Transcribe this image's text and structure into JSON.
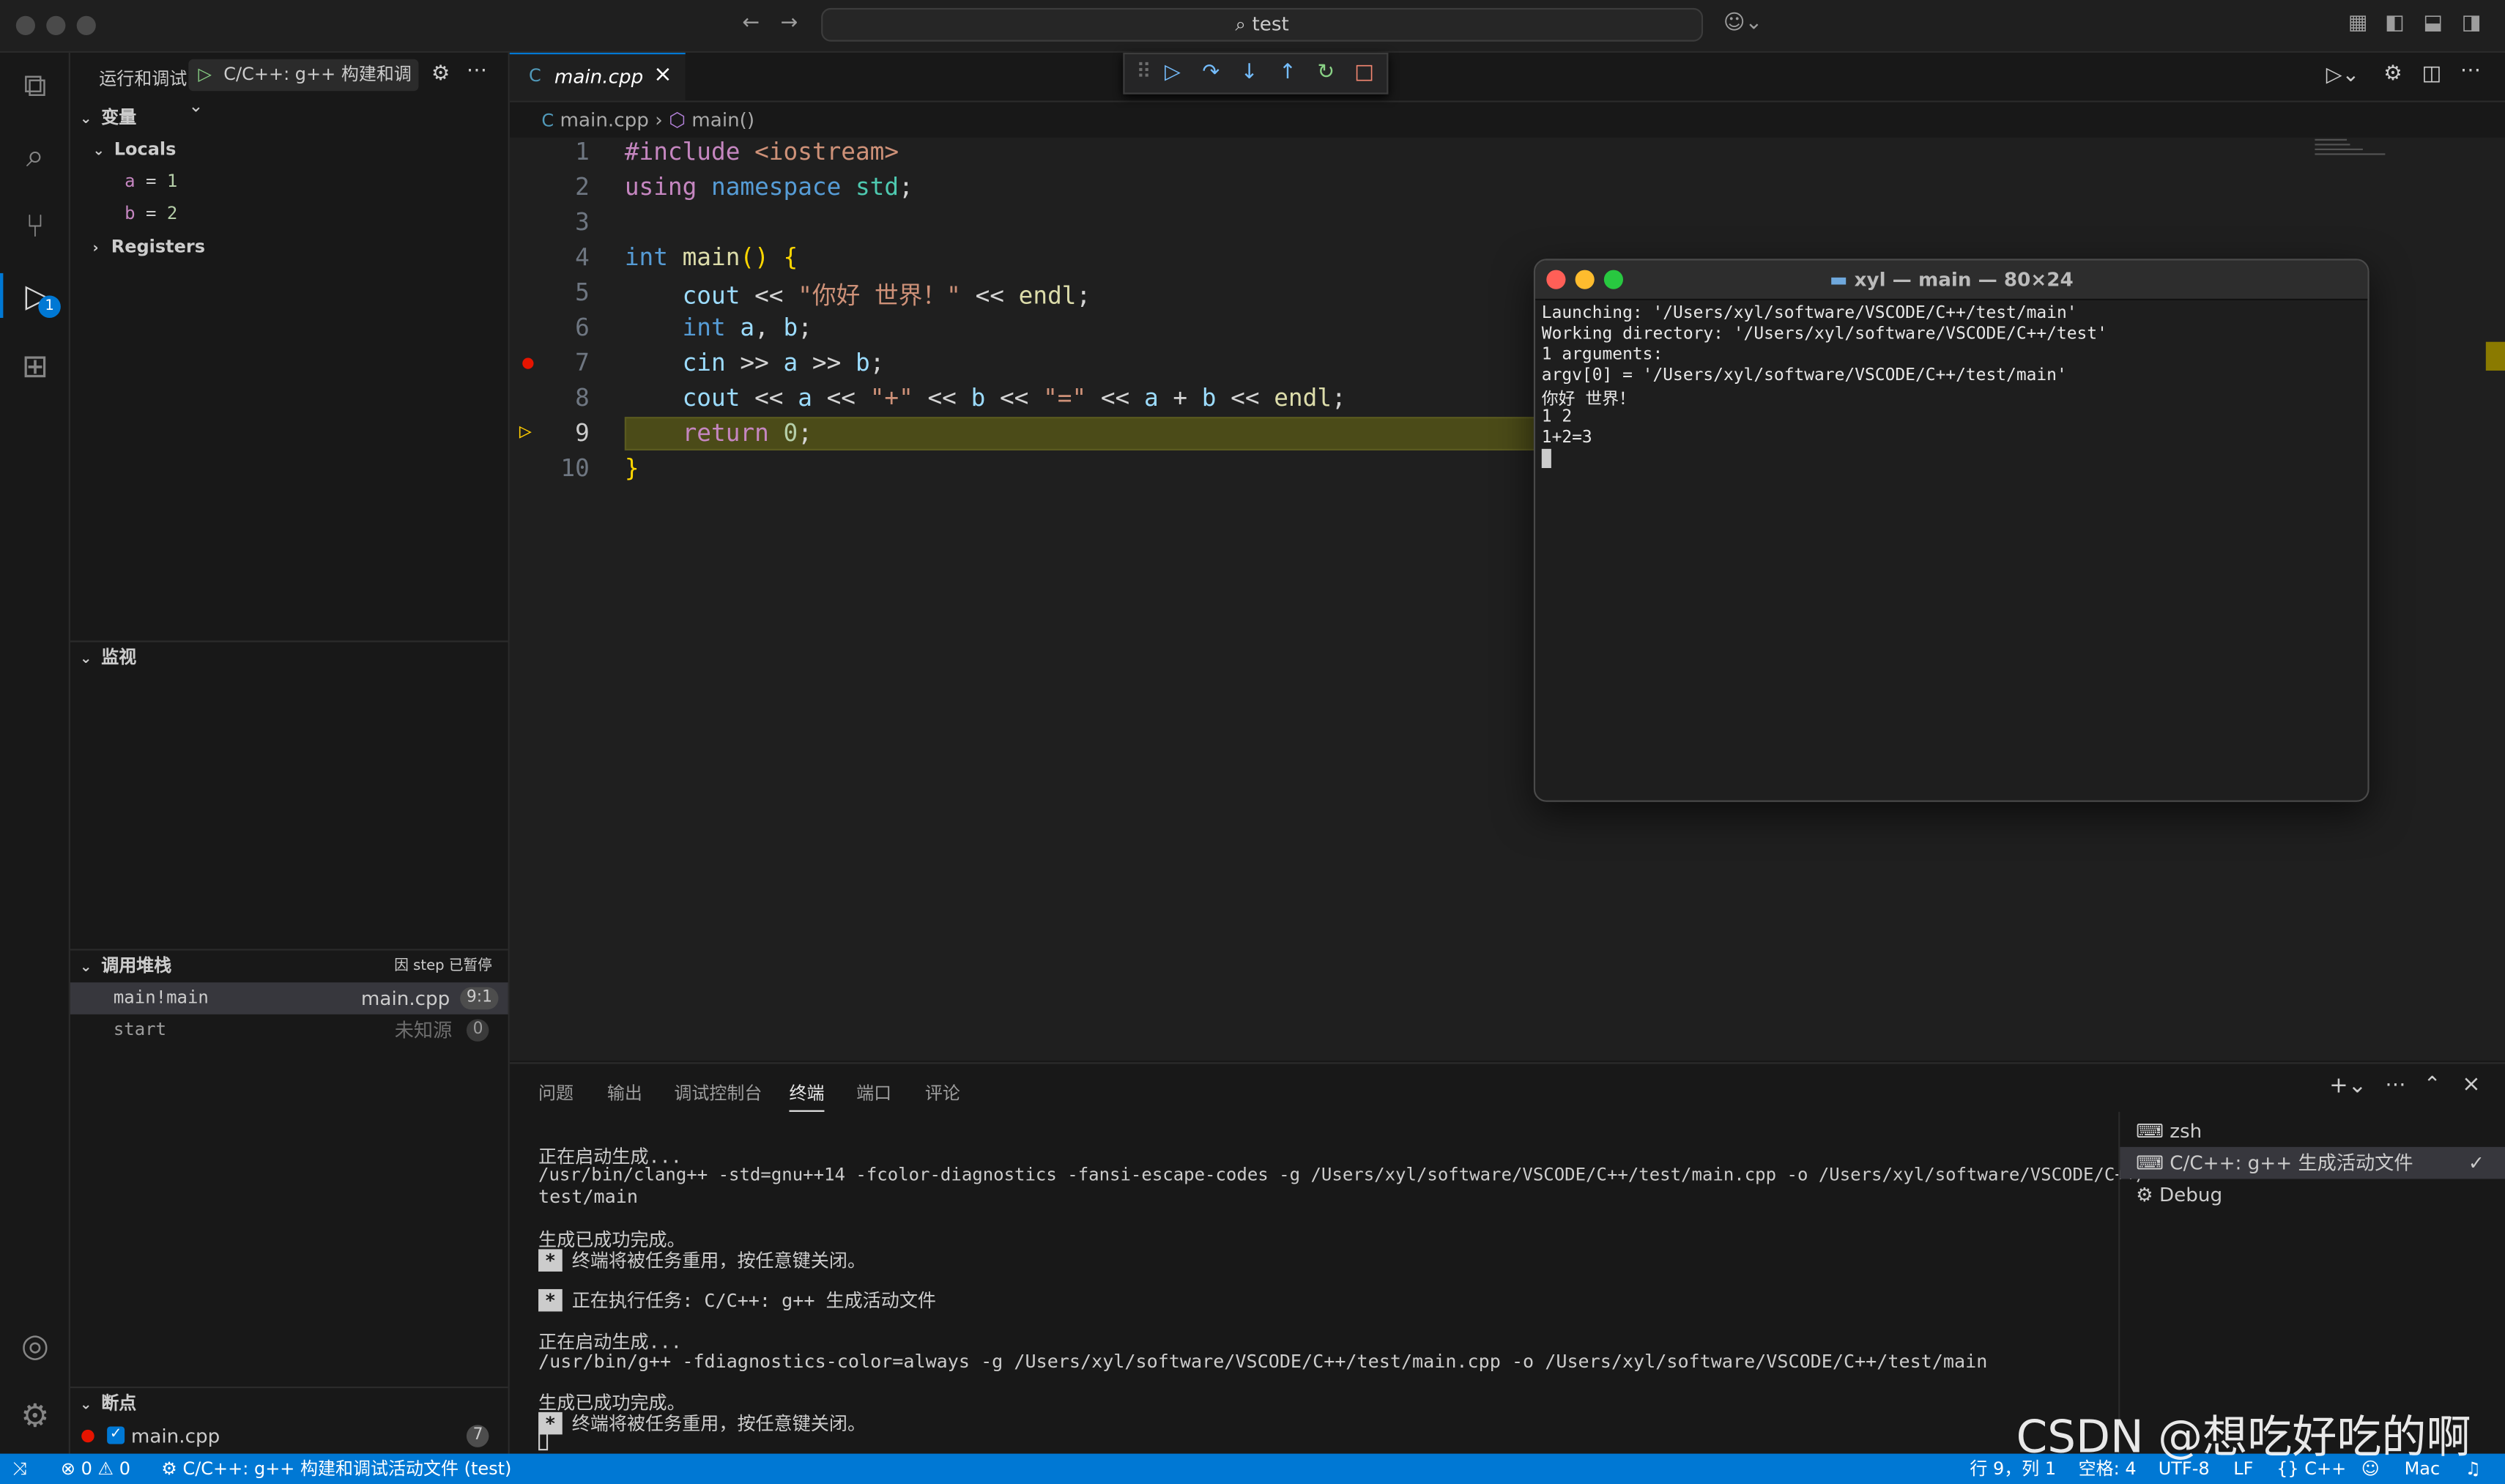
{
  "titlebar": {
    "search_text": "test"
  },
  "sidebar": {
    "run_title": "运行和调试",
    "config_name": "C/C++: g++ 构建和调",
    "variables_title": "变量",
    "locals_title": "Locals",
    "locals": [
      {
        "name": "a",
        "value": "1"
      },
      {
        "name": "b",
        "value": "2"
      }
    ],
    "registers_title": "Registers",
    "watch_title": "监视",
    "callstack_title": "调用堆栈",
    "callstack_status": "因 step 已暂停",
    "frames": [
      {
        "name": "main!main",
        "file": "main.cpp",
        "pos": "9:1"
      },
      {
        "name": "start",
        "file": "未知源",
        "pos": "0"
      }
    ],
    "breakpoints_title": "断点",
    "breakpoint_file": "main.cpp",
    "breakpoint_line": "7"
  },
  "editor": {
    "tab_label": "main.cpp",
    "breadcrumb_file": "main.cpp",
    "breadcrumb_symbol": "main()",
    "line_numbers": [
      "1",
      "2",
      "3",
      "4",
      "5",
      "6",
      "7",
      "8",
      "9",
      "10"
    ]
  },
  "terminal_window": {
    "title": "xyl — main — 80×24",
    "lines": [
      "Launching: '/Users/xyl/software/VSCODE/C++/test/main'",
      "Working directory: '/Users/xyl/software/VSCODE/C++/test'",
      "1 arguments:",
      "argv[0] = '/Users/xyl/software/VSCODE/C++/test/main'",
      "你好 世界！",
      "1 2",
      "1+2=3"
    ]
  },
  "panel": {
    "tabs": [
      "问题",
      "输出",
      "调试控制台",
      "终端",
      "端口",
      "评论"
    ],
    "lines": {
      "l1": "正在启动生成...",
      "l2": "/usr/bin/clang++ -std=gnu++14 -fcolor-diagnostics -fansi-escape-codes -g /Users/xyl/software/VSCODE/C++/test/main.cpp -o /Users/xyl/software/VSCODE/C++/",
      "l3": "test/main",
      "l4": "生成已成功完成。",
      "star": "*",
      "l5": "终端将被任务重用，按任意键关闭。",
      "l6": "正在执行任务: C/C++: g++ 生成活动文件",
      "l7": "正在启动生成...",
      "l8": "/usr/bin/g++ -fdiagnostics-color=always -g /Users/xyl/software/VSCODE/C++/test/main.cpp -o /Users/xyl/software/VSCODE/C++/test/main",
      "l9": "生成已成功完成。",
      "l10": "终端将被任务重用，按任意键关闭。"
    },
    "terminals": [
      "zsh",
      "C/C++: g++ 生成活动文件",
      "Debug"
    ]
  },
  "statusbar": {
    "errors": "0",
    "warnings": "0",
    "debug_target": "C/C++: g++ 构建和调试活动文件 (test)",
    "position": "行 9，列 1",
    "spaces": "空格: 4",
    "encoding": "UTF-8",
    "eol": "LF",
    "language": "C++",
    "platform": "Mac"
  },
  "watermark": "CSDN @想吃好吃的啊",
  "colors": {
    "accent": "#0078d4",
    "statusbar": "#0078d4",
    "current_line": "#4b4b18",
    "breakpoint": "#e51400"
  }
}
